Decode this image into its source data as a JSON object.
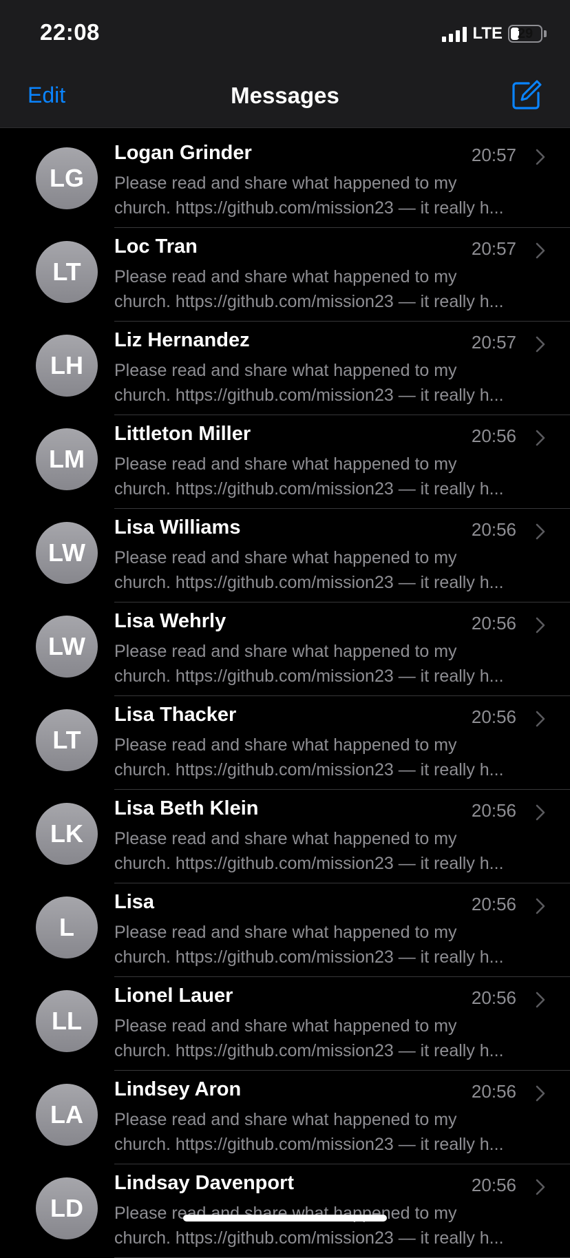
{
  "status_bar": {
    "time": "22:08",
    "network": "LTE",
    "battery": "29",
    "battery_level": 0.29
  },
  "nav": {
    "edit_label": "Edit",
    "title": "Messages",
    "compose_icon": "compose-icon"
  },
  "conversations": [
    {
      "initials": "LG",
      "name": "Logan Grinder",
      "time": "20:57",
      "preview_line1": "Please read and share what happened to my",
      "preview_line2": "church. https://github.com/mission23 — it really h..."
    },
    {
      "initials": "LT",
      "name": "Loc Tran",
      "time": "20:57",
      "preview_line1": "Please read and share what happened to my",
      "preview_line2": "church. https://github.com/mission23 — it really h..."
    },
    {
      "initials": "LH",
      "name": "Liz Hernandez",
      "time": "20:57",
      "preview_line1": "Please read and share what happened to my",
      "preview_line2": "church. https://github.com/mission23 — it really h..."
    },
    {
      "initials": "LM",
      "name": "Littleton Miller",
      "time": "20:56",
      "preview_line1": "Please read and share what happened to my",
      "preview_line2": "church. https://github.com/mission23 — it really h..."
    },
    {
      "initials": "LW",
      "name": "Lisa Williams",
      "time": "20:56",
      "preview_line1": "Please read and share what happened to my",
      "preview_line2": "church. https://github.com/mission23 — it really h..."
    },
    {
      "initials": "LW",
      "name": "Lisa Wehrly",
      "time": "20:56",
      "preview_line1": "Please read and share what happened to my",
      "preview_line2": "church. https://github.com/mission23 — it really h..."
    },
    {
      "initials": "LT",
      "name": "Lisa Thacker",
      "time": "20:56",
      "preview_line1": "Please read and share what happened to my",
      "preview_line2": "church. https://github.com/mission23 — it really h..."
    },
    {
      "initials": "LK",
      "name": "Lisa Beth Klein",
      "time": "20:56",
      "preview_line1": "Please read and share what happened to my",
      "preview_line2": "church. https://github.com/mission23 — it really h..."
    },
    {
      "initials": "L",
      "name": "Lisa",
      "time": "20:56",
      "preview_line1": "Please read and share what happened to my",
      "preview_line2": "church. https://github.com/mission23 — it really h..."
    },
    {
      "initials": "LL",
      "name": "Lionel Lauer",
      "time": "20:56",
      "preview_line1": "Please read and share what happened to my",
      "preview_line2": "church. https://github.com/mission23 — it really h..."
    },
    {
      "initials": "LA",
      "name": "Lindsey Aron",
      "time": "20:56",
      "preview_line1": "Please read and share what happened to my",
      "preview_line2": "church. https://github.com/mission23 — it really h..."
    },
    {
      "initials": "LD",
      "name": "Lindsay Davenport",
      "time": "20:56",
      "preview_line1": "Please read and share what happened to my",
      "preview_line2": "church. https://github.com/mission23 — it really h..."
    }
  ],
  "colors": {
    "accent": "#0a84ff",
    "background": "#000000",
    "header": "#1c1c1e",
    "secondary_text": "#8e8e93"
  }
}
